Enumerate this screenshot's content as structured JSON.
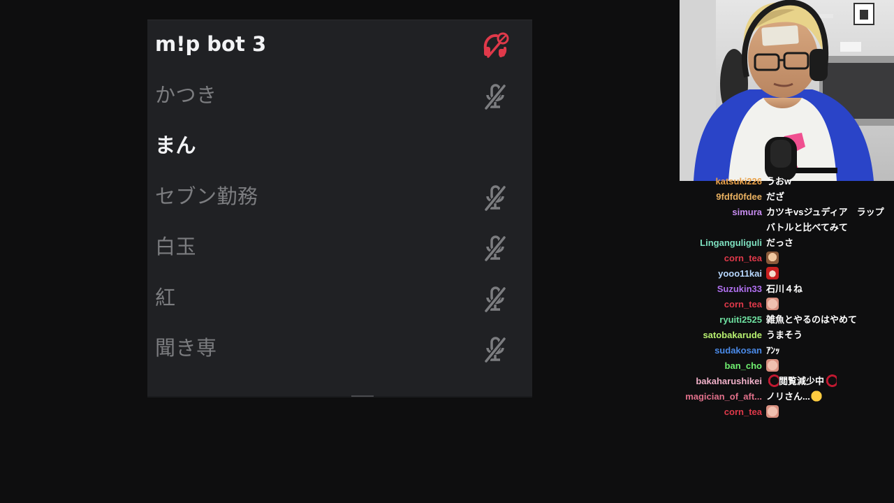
{
  "voice_panel": {
    "members": [
      {
        "name": "m!p bot 3",
        "status": "deafened-headphones-icon",
        "style": "bot"
      },
      {
        "name": "かつき",
        "status": "muted-mic-icon",
        "style": "dim"
      },
      {
        "name": "まん",
        "status": "",
        "style": "active"
      },
      {
        "name": "セブン勤務",
        "status": "muted-mic-icon",
        "style": "dim"
      },
      {
        "name": "白玉",
        "status": "muted-mic-icon",
        "style": "dim"
      },
      {
        "name": "紅",
        "status": "muted-mic-icon",
        "style": "dim"
      },
      {
        "name": "聞き専",
        "status": "muted-mic-icon",
        "style": "dim"
      }
    ],
    "colors": {
      "background": "#202124",
      "deafened_icon": "#e0394a",
      "muted_icon": "#7c7d80"
    }
  },
  "chat": {
    "messages": [
      {
        "user": "katsuki226",
        "color": "#e8a048",
        "text": "うおw"
      },
      {
        "user": "9fdfd0fdee",
        "color": "#e8b060",
        "text": "だざ"
      },
      {
        "user": "simura",
        "color": "#c78cf0",
        "text": "カツキvsジュディア　ラップバトルと比べてみて"
      },
      {
        "user": "Linganguliguli",
        "color": "#7ee0c0",
        "text": "だっさ"
      },
      {
        "user": "corn_tea",
        "color": "#e0394a",
        "text": "",
        "emote": "sad-girl-emote"
      },
      {
        "user": "yooo11kai",
        "color": "#b8d8ff",
        "text": "",
        "emote": "red-face-emote"
      },
      {
        "user": "Suzukin33",
        "color": "#b070f0",
        "text": "石川４ね"
      },
      {
        "user": "corn_tea",
        "color": "#e0394a",
        "text": "",
        "emote": "face-emote"
      },
      {
        "user": "ryuiti2525",
        "color": "#6ee0a0",
        "text": "雑魚とやるのはやめて"
      },
      {
        "user": "satobakarude",
        "color": "#b8f070",
        "text": "うまそう"
      },
      {
        "user": "sudakosan",
        "color": "#4a8ae8",
        "text": "ｱﾝｯ"
      },
      {
        "user": "ban_cho",
        "color": "#70f070",
        "text": "",
        "emote": "face-emote"
      },
      {
        "user": "bakaharushikei",
        "color": "#f0b0c8",
        "text": "閲覧減少中",
        "emote": "red-crescent-emote"
      },
      {
        "user": "magician_of_aft...",
        "color": "#e0708a",
        "text": "ノリさん...",
        "emote": "grin-emoji"
      },
      {
        "user": "corn_tea",
        "color": "#e0394a",
        "text": "",
        "emote": "face-emote"
      }
    ]
  },
  "webcam": {
    "label": "streamer-webcam"
  }
}
